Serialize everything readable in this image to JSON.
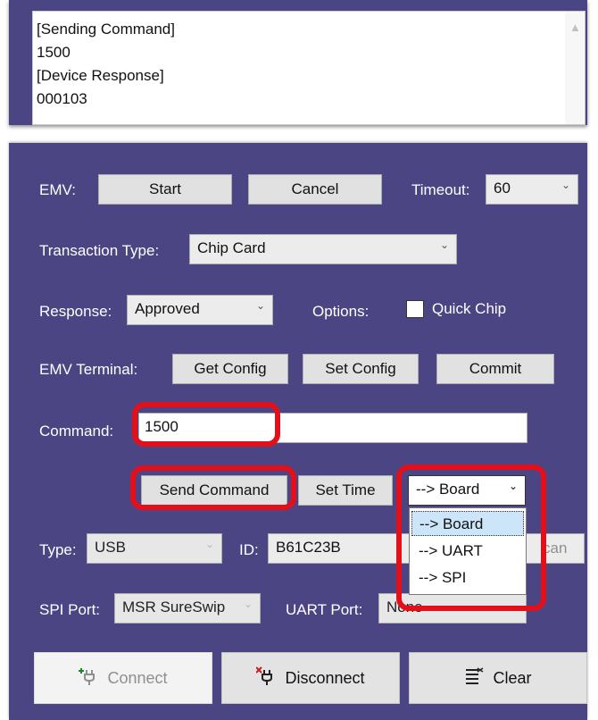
{
  "log": {
    "lines": [
      "[Sending Command]",
      "1500",
      "[Device Response]",
      "000103"
    ]
  },
  "emv": {
    "label": "EMV:",
    "start_button": "Start",
    "cancel_button": "Cancel",
    "timeout_label": "Timeout:",
    "timeout_value": "60"
  },
  "transaction": {
    "label": "Transaction Type:",
    "value": "Chip Card"
  },
  "response": {
    "label": "Response:",
    "value": "Approved",
    "options_label": "Options:",
    "quick_chip_label": "Quick Chip",
    "quick_chip_checked": false
  },
  "terminal": {
    "label": "EMV Terminal:",
    "get_config": "Get Config",
    "set_config": "Set Config",
    "commit": "Commit"
  },
  "command": {
    "label": "Command:",
    "value": "1500"
  },
  "actions": {
    "send_command": "Send Command",
    "set_time": "Set Time",
    "target_value": "--> Board",
    "target_options": [
      "--> Board",
      "--> UART",
      "--> SPI"
    ],
    "target_selected_index": 0
  },
  "device": {
    "type_label": "Type:",
    "type_value": "USB",
    "id_label": "ID:",
    "id_value": "B61C23B",
    "scan_partial": "can"
  },
  "ports": {
    "spi_label": "SPI Port:",
    "spi_value": "MSR SureSwip",
    "uart_label": "UART Port:",
    "uart_value": "None"
  },
  "footer": {
    "connect": "Connect",
    "disconnect": "Disconnect",
    "clear": "Clear"
  },
  "colors": {
    "panel": "#4b4584",
    "highlight": "#e3101c"
  }
}
